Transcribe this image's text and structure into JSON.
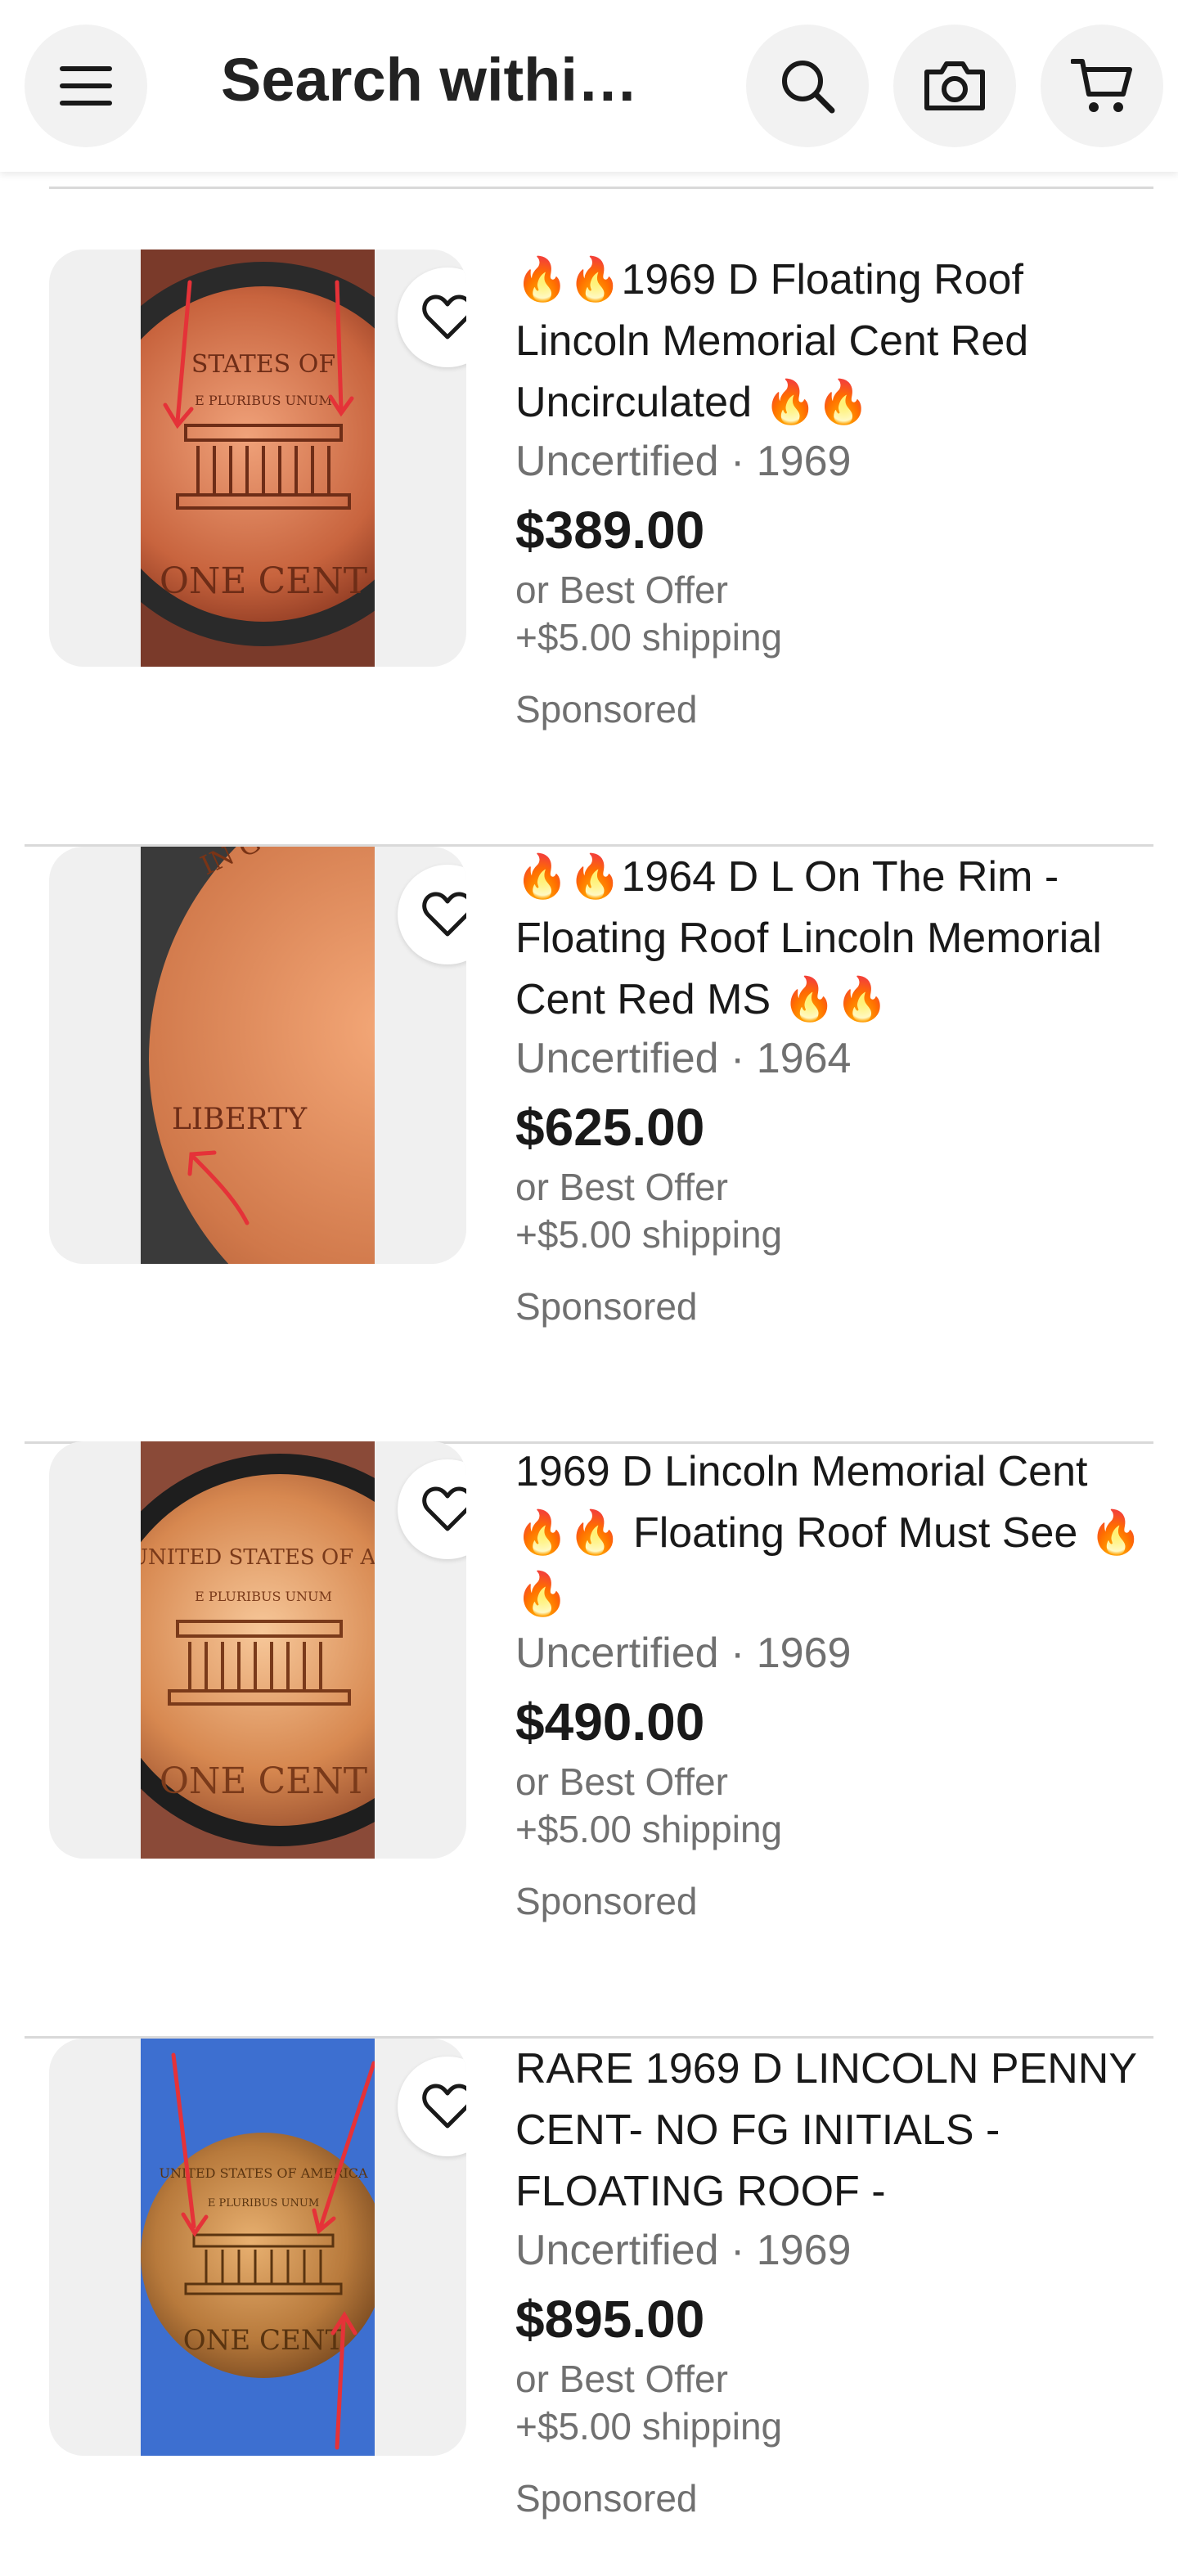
{
  "header": {
    "search_text": "Search withi…",
    "menu_icon": "hamburger-menu-icon",
    "search_icon": "search-icon",
    "camera_icon": "camera-icon",
    "cart_icon": "cart-icon"
  },
  "colors": {
    "accent_red": "#e53238",
    "text_primary": "#191919",
    "text_secondary": "#707070",
    "thumb_bg": "#f0f0f0"
  },
  "listings": [
    {
      "title": "🔥🔥1969 D Floating Roof Lincoln Memorial Cent Red Uncirculated 🔥🔥",
      "meta": "Uncertified · 1969",
      "price": "$389.00",
      "offer": "or Best Offer",
      "shipping": "+$5.00 shipping",
      "sponsored": "Sponsored",
      "coin": {
        "side": "reverse",
        "top_text": "STATES OF",
        "bottom_text": "ONE CENT",
        "motto": "E PLURIBUS UNUM"
      }
    },
    {
      "title": "🔥🔥1964 D L On The Rim - Floating Roof Lincoln Memorial Cent Red MS 🔥🔥",
      "meta": "Uncertified · 1964",
      "price": "$625.00",
      "offer": "or Best Offer",
      "shipping": "+$5.00 shipping",
      "sponsored": "Sponsored",
      "coin": {
        "side": "obverse",
        "top_text": "IN GO",
        "bottom_text": "LIBERTY",
        "motto": ""
      }
    },
    {
      "title": "1969 D Lincoln Memorial Cent 🔥🔥 Floating Roof Must See 🔥🔥",
      "meta": "Uncertified · 1969",
      "price": "$490.00",
      "offer": "or Best Offer",
      "shipping": "+$5.00 shipping",
      "sponsored": "Sponsored",
      "coin": {
        "side": "reverse",
        "top_text": "UNITED STATES OF AME",
        "bottom_text": "ONE CENT",
        "motto": "E PLURIBUS UNUM"
      }
    },
    {
      "title": "RARE 1969 D LINCOLN PENNY CENT- NO FG INITIALS - FLOATING ROOF -",
      "meta": "Uncertified · 1969",
      "price": "$895.00",
      "offer": "or Best Offer",
      "shipping": "+$5.00 shipping",
      "sponsored": "Sponsored",
      "coin": {
        "side": "reverse",
        "top_text": "UNITED STATES OF AMERICA",
        "bottom_text": "ONE CENT",
        "motto": "E PLURIBUS UNUM"
      }
    }
  ]
}
